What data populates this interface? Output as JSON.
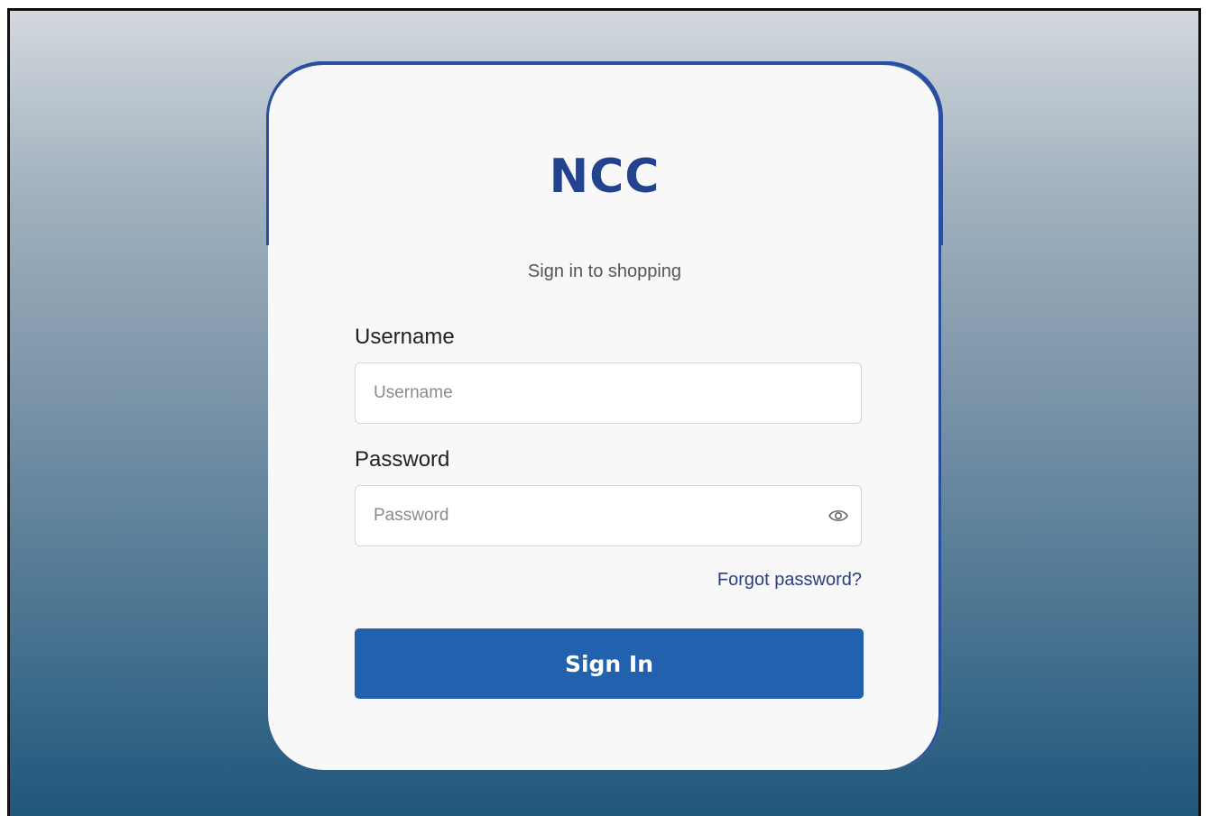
{
  "brand": {
    "logo_text": "NCC",
    "subtitle": "Sign in to shopping"
  },
  "form": {
    "username": {
      "label": "Username",
      "placeholder": "Username",
      "value": ""
    },
    "password": {
      "label": "Password",
      "placeholder": "Password",
      "value": "",
      "toggle_icon": "eye-icon"
    },
    "forgot_link": "Forgot password?",
    "submit_label": "Sign In"
  },
  "colors": {
    "brand_blue": "#24438f",
    "button_blue": "#2161ad",
    "card_border": "#2a4ea0",
    "link_blue": "#2a3f7e",
    "background_top": "#d3d8dd",
    "background_bottom": "#20577c"
  }
}
